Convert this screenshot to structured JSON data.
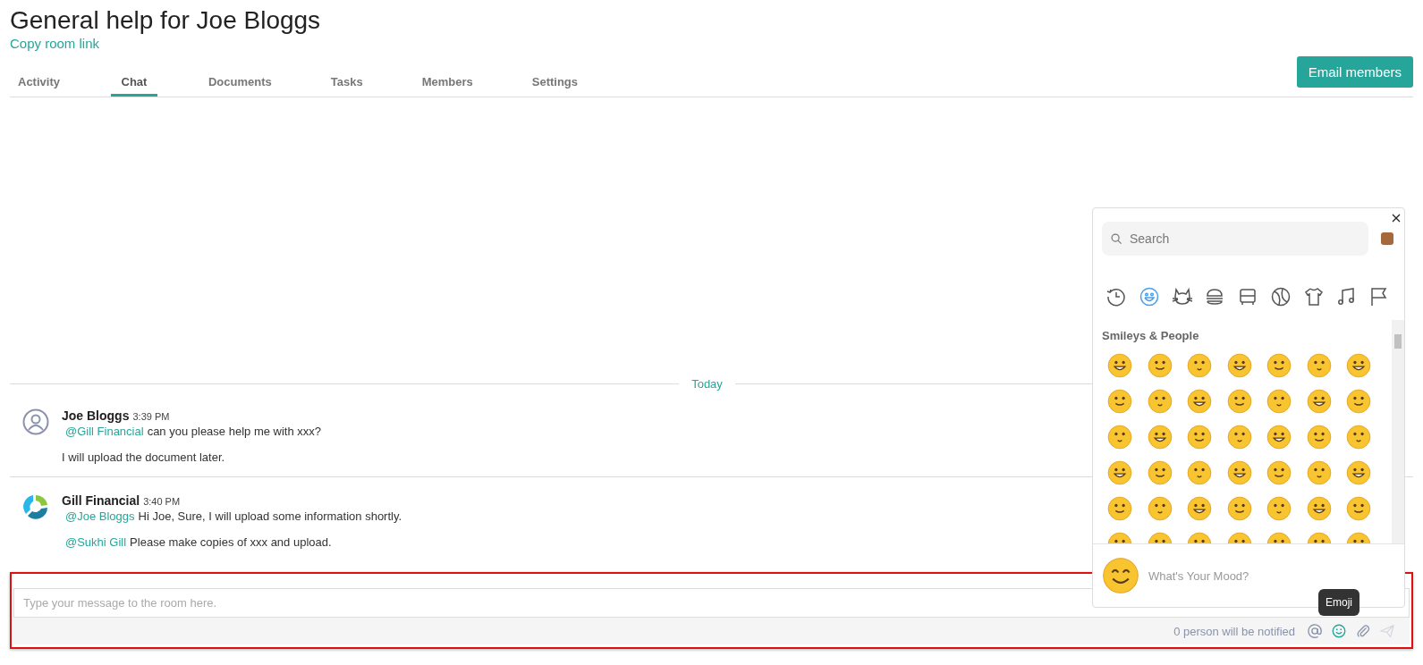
{
  "room": {
    "title": "General help for Joe Bloggs",
    "link": "Copy room link"
  },
  "tabs": [
    {
      "label": "Activity",
      "selected": false
    },
    {
      "label": "Chat",
      "selected": true
    },
    {
      "label": "Documents",
      "selected": false
    },
    {
      "label": "Tasks",
      "selected": false
    },
    {
      "label": "Members",
      "selected": false
    },
    {
      "label": "Settings",
      "selected": false
    }
  ],
  "email_button": "Email members",
  "day_divider": "Today",
  "messages": [
    {
      "kind": "user",
      "author": "Joe Bloggs",
      "time": "3:39 PM",
      "lines": [
        {
          "mention": "@Gill Financial",
          "text": "can you please help me with xxx?"
        },
        {
          "text": "I will upload the document later."
        }
      ]
    },
    {
      "kind": "logo",
      "author": "Gill Financial",
      "time": "3:40 PM",
      "lines": [
        {
          "mention": "@Joe Bloggs",
          "text": "Hi Joe, Sure, I will upload some information shortly."
        },
        {
          "mention": "@Sukhi Gill",
          "text": "Please make copies of xxx and upload."
        }
      ]
    }
  ],
  "composer": {
    "placeholder": "Type your message to the room here.",
    "notice": "0 person will be notified",
    "tooltip": "Emoji"
  },
  "emoji_picker": {
    "search_placeholder": "Search",
    "section": "Smileys & People",
    "mood_prompt": "What's Your Mood?",
    "categories": [
      {
        "kind": "recent",
        "selected": false
      },
      {
        "kind": "smileys",
        "selected": true
      },
      {
        "kind": "animals",
        "selected": false
      },
      {
        "kind": "food",
        "selected": false
      },
      {
        "kind": "travel",
        "selected": false
      },
      {
        "kind": "activity",
        "selected": false
      },
      {
        "kind": "objects",
        "selected": false
      },
      {
        "kind": "symbols",
        "selected": false
      },
      {
        "kind": "flags",
        "selected": false
      }
    ]
  }
}
